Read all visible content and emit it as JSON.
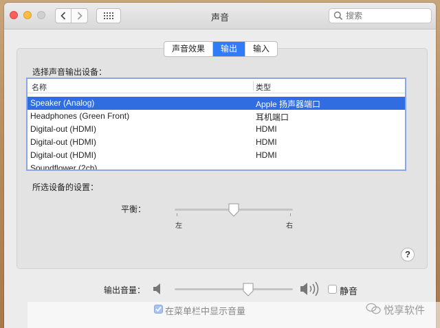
{
  "window": {
    "title": "声音"
  },
  "search": {
    "placeholder": "搜索"
  },
  "tabs": [
    {
      "label": "声音效果",
      "active": false
    },
    {
      "label": "输出",
      "active": true
    },
    {
      "label": "输入",
      "active": false
    }
  ],
  "output": {
    "select_label": "选择声音输出设备：",
    "columns": {
      "name": "名称",
      "type": "类型"
    },
    "devices": [
      {
        "name": "Speaker (Analog)",
        "type": "Apple 扬声器端口",
        "selected": true
      },
      {
        "name": "Headphones (Green Front)",
        "type": "耳机端口",
        "selected": false
      },
      {
        "name": "Digital-out (HDMI)",
        "type": "HDMI",
        "selected": false
      },
      {
        "name": "Digital-out (HDMI)",
        "type": "HDMI",
        "selected": false
      },
      {
        "name": "Digital-out (HDMI)",
        "type": "HDMI",
        "selected": false
      },
      {
        "name": "Soundflower (2ch)",
        "type": "",
        "selected": false
      }
    ],
    "settings_label": "所选设备的设置：",
    "balance": {
      "label": "平衡：",
      "left_label": "左",
      "right_label": "右",
      "value": 0.5
    }
  },
  "volume": {
    "label": "输出音量：",
    "value": 0.62,
    "mute_label": "静音",
    "muted": false
  },
  "menubar_toggle": {
    "label": "在菜单栏中显示音量",
    "checked": true
  },
  "watermark": {
    "text": "悦享软件"
  },
  "colors": {
    "accent": "#2f7cf6",
    "selection": "#2f6de0",
    "table_border": "#8aa6e6"
  }
}
